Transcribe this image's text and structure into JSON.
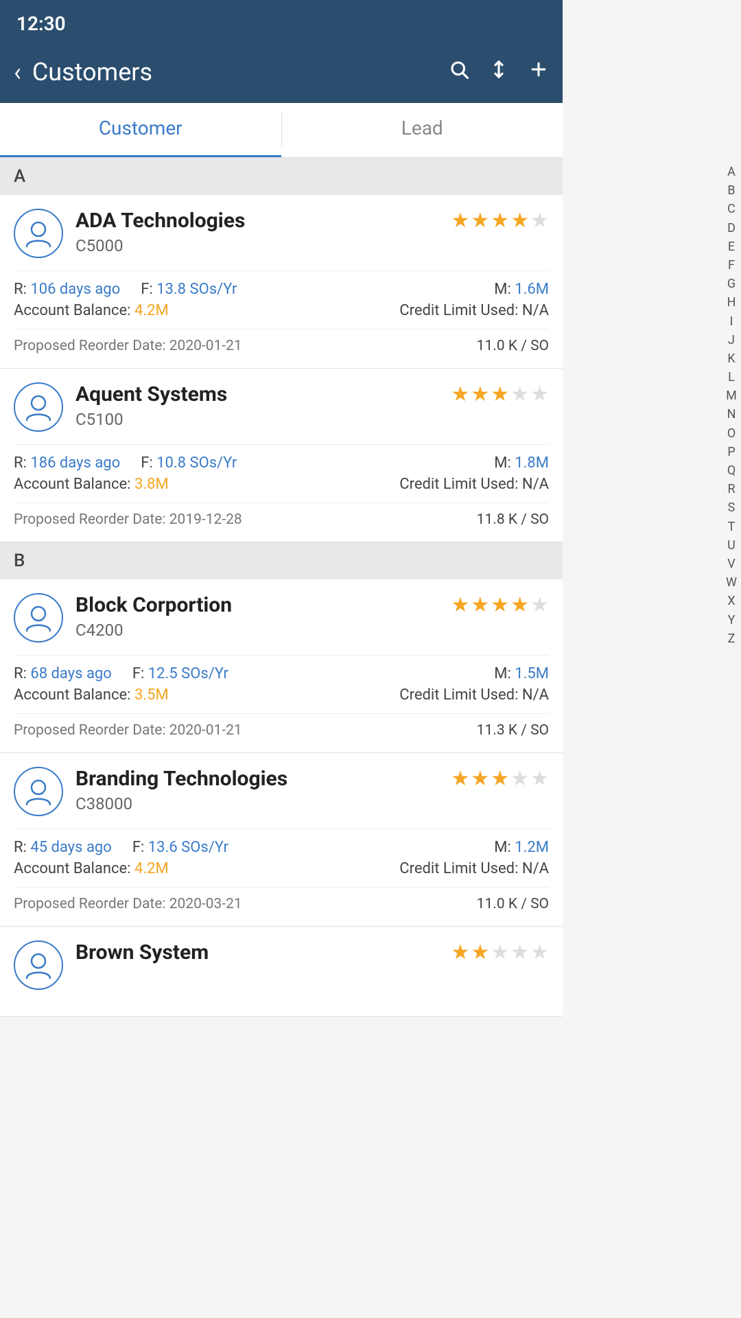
{
  "statusBar": {
    "time": "12:30"
  },
  "header": {
    "title": "Customers",
    "backLabel": "‹",
    "icons": {
      "search": "⌕",
      "sort": "⇅",
      "add": "+"
    }
  },
  "tabs": [
    {
      "label": "Customer",
      "active": true
    },
    {
      "label": "Lead",
      "active": false
    }
  ],
  "sections": [
    {
      "letter": "A",
      "customers": [
        {
          "name": "ADA Technologies",
          "code": "C5000",
          "stars": 4,
          "maxStars": 5,
          "recency": "106 days ago",
          "frequency": "13.8 SOs/Yr",
          "monetary": "1.6M",
          "accountBalance": "4.2M",
          "creditLimitUsed": "N/A",
          "reorderDate": "2020-01-21",
          "reorderValue": "11.0 K / SO"
        },
        {
          "name": "Aquent Systems",
          "code": "C5100",
          "stars": 3,
          "maxStars": 5,
          "recency": "186 days ago",
          "frequency": "10.8 SOs/Yr",
          "monetary": "1.8M",
          "accountBalance": "3.8M",
          "creditLimitUsed": "N/A",
          "reorderDate": "2019-12-28",
          "reorderValue": "11.8 K / SO"
        }
      ]
    },
    {
      "letter": "B",
      "customers": [
        {
          "name": "Block Corportion",
          "code": "C4200",
          "stars": 4,
          "maxStars": 5,
          "recency": "68 days ago",
          "frequency": "12.5 SOs/Yr",
          "monetary": "1.5M",
          "accountBalance": "3.5M",
          "creditLimitUsed": "N/A",
          "reorderDate": "2020-01-21",
          "reorderValue": "11.3 K / SO"
        },
        {
          "name": "Branding Technologies",
          "code": "C38000",
          "stars": 3,
          "maxStars": 5,
          "recency": "45 days ago",
          "frequency": "13.6 SOs/Yr",
          "monetary": "1.2M",
          "accountBalance": "4.2M",
          "creditLimitUsed": "N/A",
          "reorderDate": "2020-03-21",
          "reorderValue": "11.0 K / SO"
        },
        {
          "name": "Brown System",
          "code": "",
          "stars": 2,
          "maxStars": 5,
          "recency": "",
          "frequency": "",
          "monetary": "",
          "accountBalance": "",
          "creditLimitUsed": "",
          "reorderDate": "",
          "reorderValue": "",
          "partial": true
        }
      ]
    }
  ],
  "alphabet": [
    "A",
    "B",
    "C",
    "D",
    "E",
    "F",
    "G",
    "H",
    "I",
    "J",
    "K",
    "L",
    "M",
    "N",
    "O",
    "P",
    "Q",
    "R",
    "S",
    "T",
    "U",
    "V",
    "W",
    "X",
    "Y",
    "Z"
  ]
}
